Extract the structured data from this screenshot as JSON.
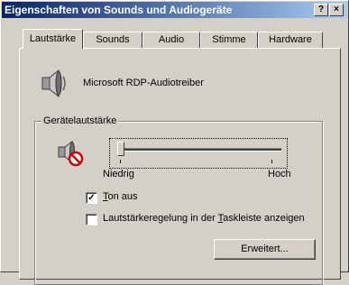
{
  "window": {
    "title": "Eigenschaften von Sounds und Audiogeräte",
    "help_label": "?",
    "close_label": "×"
  },
  "tabs": [
    {
      "label": "Lautstärke",
      "active": true
    },
    {
      "label": "Sounds",
      "active": false
    },
    {
      "label": "Audio",
      "active": false
    },
    {
      "label": "Stimme",
      "active": false
    },
    {
      "label": "Hardware",
      "active": false
    }
  ],
  "device": {
    "name": "Microsoft RDP-Audiotreiber",
    "icon": "speaker-icon"
  },
  "group": {
    "label": "Gerätelautstärke",
    "volume_icon": "speaker-muted-icon",
    "slider": {
      "value": 0,
      "min_label": "Niedrig",
      "max_label": "Hoch"
    },
    "mute_checkbox": {
      "label": "Ton aus",
      "checked": true
    },
    "taskbar_checkbox": {
      "label": "Lautstärkeregelung in der Taskleiste anzeigen",
      "checked": false
    },
    "advanced_button": "Erweitert..."
  }
}
